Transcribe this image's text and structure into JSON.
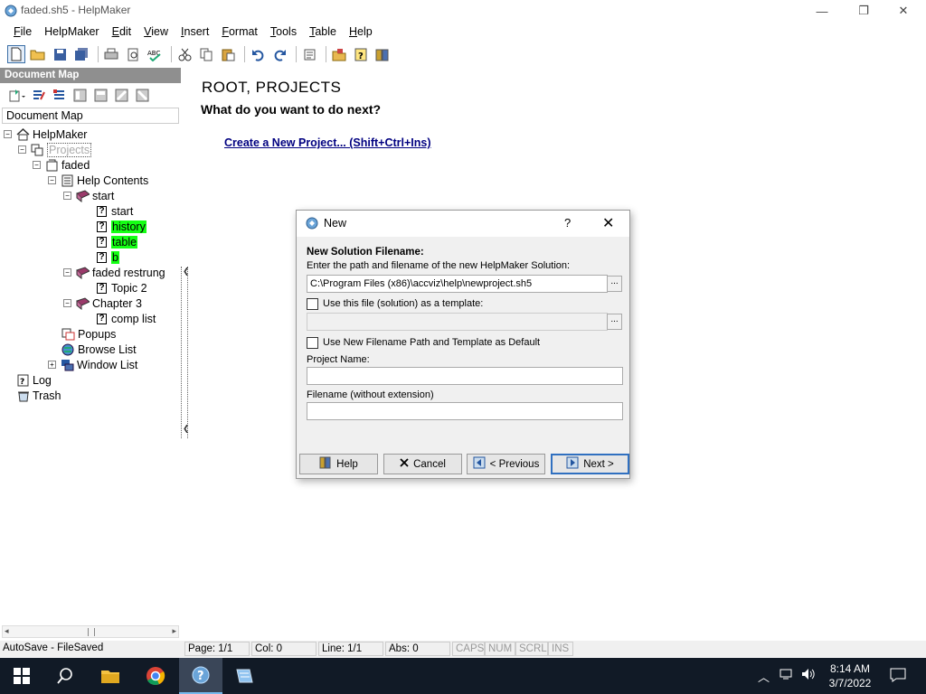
{
  "window": {
    "title": "faded.sh5 - HelpMaker",
    "minimize_glyph": "—",
    "restore_glyph": "❐",
    "close_glyph": "✕"
  },
  "menu": [
    {
      "label": "File",
      "u": "F",
      "rest": "ile"
    },
    {
      "label": "HelpMaker",
      "u": "",
      "rest": "HelpMaker"
    },
    {
      "label": "Edit",
      "u": "E",
      "rest": "dit"
    },
    {
      "label": "View",
      "u": "V",
      "rest": "iew"
    },
    {
      "label": "Insert",
      "u": "I",
      "rest": "nsert"
    },
    {
      "label": "Format",
      "u": "F",
      "rest": "ormat"
    },
    {
      "label": "Tools",
      "u": "T",
      "rest": "ools"
    },
    {
      "label": "Table",
      "u": "T",
      "rest": "able"
    },
    {
      "label": "Help",
      "u": "H",
      "rest": "elp"
    }
  ],
  "docmap": {
    "header": "Document Map",
    "subheader": "Document Map"
  },
  "tree": {
    "root": "HelpMaker",
    "projects": "Projects",
    "faded": "faded",
    "help_contents": "Help Contents",
    "start_book": "start",
    "start_topic": "start",
    "history": "history",
    "table": "table",
    "b": "b",
    "faded_restrung": "faded restrung",
    "topic2": "Topic 2",
    "chapter3": "Chapter 3",
    "comp_list": "comp list",
    "popups": "Popups",
    "browse_list": "Browse List",
    "window_list": "Window List",
    "log": "Log",
    "trash": "Trash"
  },
  "main": {
    "heading": "ROOT, PROJECTS",
    "question": "What do you want to do next?",
    "link": "Create a New Project... (Shift+Ctrl+Ins)"
  },
  "dialog": {
    "title": "New",
    "help_glyph": "?",
    "close_glyph": "✕",
    "section_title": "New Solution Filename:",
    "instruction": "Enter the path and filename of the new HelpMaker Solution:",
    "path_value": "C:\\Program Files (x86)\\accviz\\help\\newproject.sh5",
    "browse": "...",
    "template_checkbox": "Use this file (solution) as a template:",
    "template_value": "",
    "default_checkbox": "Use New Filename Path and Template as Default",
    "project_name_label": "Project Name:",
    "project_name_value": "",
    "filename_label": "Filename (without extension)",
    "filename_value": "",
    "btn_help": "Help",
    "btn_cancel": "Cancel",
    "btn_previous": "< Previous",
    "btn_next": "Next >"
  },
  "status": {
    "autosave": "AutoSave - FileSaved",
    "page": "Page: 1/1",
    "col": "Col: 0",
    "line": "Line: 1/1",
    "abs": "Abs: 0",
    "caps": "CAPS",
    "num": "NUM",
    "scrl": "SCRL",
    "ins": "INS"
  },
  "taskbar": {
    "time": "8:14 AM",
    "date": "3/7/2022"
  },
  "colors": {
    "highlight": "#14ff14",
    "link": "#000080",
    "taskbar": "#111a26"
  }
}
